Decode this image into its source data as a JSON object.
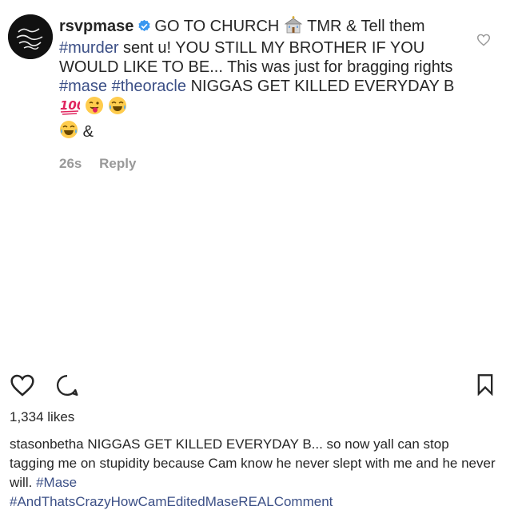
{
  "comment": {
    "username": "rsvpmase",
    "text_1": "GO TO CHURCH",
    "text_2": "TMR & Tell them",
    "hashtag_murder": "#murder",
    "text_3": "sent u!  YOU STILL MY BROTHER IF YOU WOULD LIKE TO BE... This was just for bragging rights",
    "hashtag_mase": "#mase",
    "hashtag_theoracle": "#theoracle",
    "text_4": "NIGGAS GET KILLED EVERYDAY B",
    "text_5": "&",
    "time": "26s",
    "reply_label": "Reply"
  },
  "post": {
    "likes": "1,334 likes"
  },
  "caption": {
    "username": "stasonbetha",
    "text": "NIGGAS GET KILLED EVERYDAY B... so now yall can stop tagging me on stupidity because Cam know he never slept with me and he never will.",
    "hashtag_1": "#Mase",
    "hashtag_2": "#AndThatsCrazyHowCamEditedMaseREALComment"
  },
  "icons": {
    "verified": "verified-badge-icon",
    "church": "church-emoji-icon",
    "hundred": "hundred-points-emoji-icon",
    "wink_tongue": "winking-face-tongue-emoji-icon",
    "tears_joy": "tears-of-joy-emoji-icon",
    "heart": "heart-outline-icon",
    "comment": "comment-bubble-icon",
    "bookmark": "bookmark-outline-icon"
  },
  "colors": {
    "text": "#262626",
    "hashtag": "#3b4f86",
    "muted": "#999999",
    "verified": "#3897f0"
  }
}
